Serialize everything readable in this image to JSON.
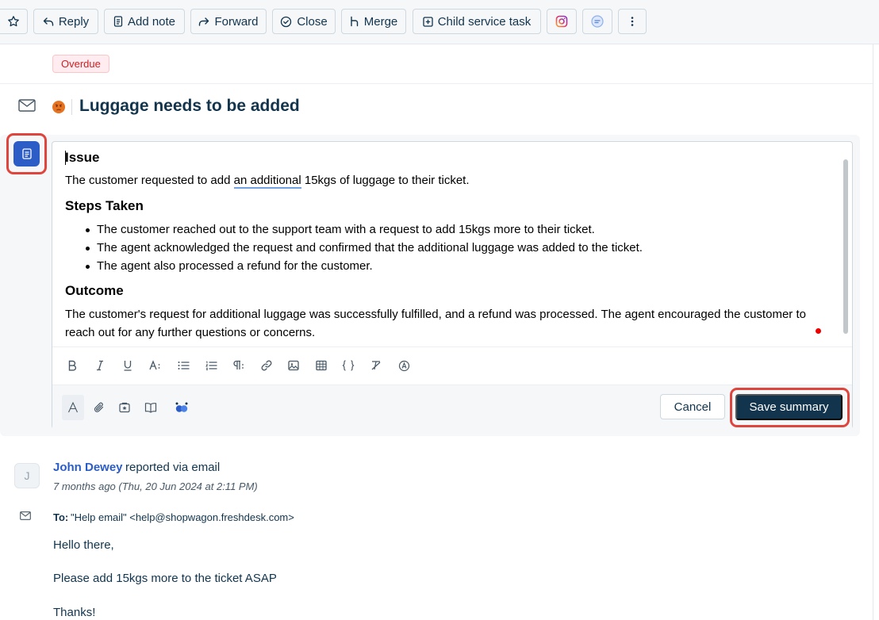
{
  "toolbar": {
    "reply_label": "Reply",
    "add_note_label": "Add note",
    "forward_label": "Forward",
    "close_label": "Close",
    "merge_label": "Merge",
    "child_task_label": "Child service task"
  },
  "ticket": {
    "status_badge": "Overdue",
    "title": "Luggage needs to be added"
  },
  "summary": {
    "issue_heading": "Issue",
    "issue_text_before": "The customer requested to add ",
    "issue_text_marked": "an additional",
    "issue_text_after": " 15kgs of luggage to their ticket.",
    "steps_heading": "Steps Taken",
    "steps": [
      "The customer reached out to the support team with a request to add 15kgs more to their ticket.",
      "The agent acknowledged the request and confirmed that the additional luggage was added to the ticket.",
      "The agent also processed a refund for the customer."
    ],
    "outcome_heading": "Outcome",
    "outcome_text": "The customer's request for additional luggage was successfully fulfilled, and a refund was processed. The agent encouraged the customer to reach out for any further questions or concerns.",
    "cancel_label": "Cancel",
    "save_label": "Save summary"
  },
  "conversation": {
    "avatar_initial": "J",
    "author": "John Dewey",
    "via": "reported via email",
    "timestamp": "7 months ago (Thu, 20 Jun 2024 at 2:11 PM)",
    "to_label": "To:",
    "to_value": "\"Help email\" <help@shopwagon.freshdesk.com>",
    "body": [
      "Hello there,",
      "Please add 15kgs more to the ticket ASAP",
      "Thanks!"
    ]
  },
  "colors": {
    "primary_dark": "#12344d",
    "accent_blue": "#2c5cc5",
    "highlight_red": "#e0453d",
    "overdue_red": "#c82124"
  }
}
